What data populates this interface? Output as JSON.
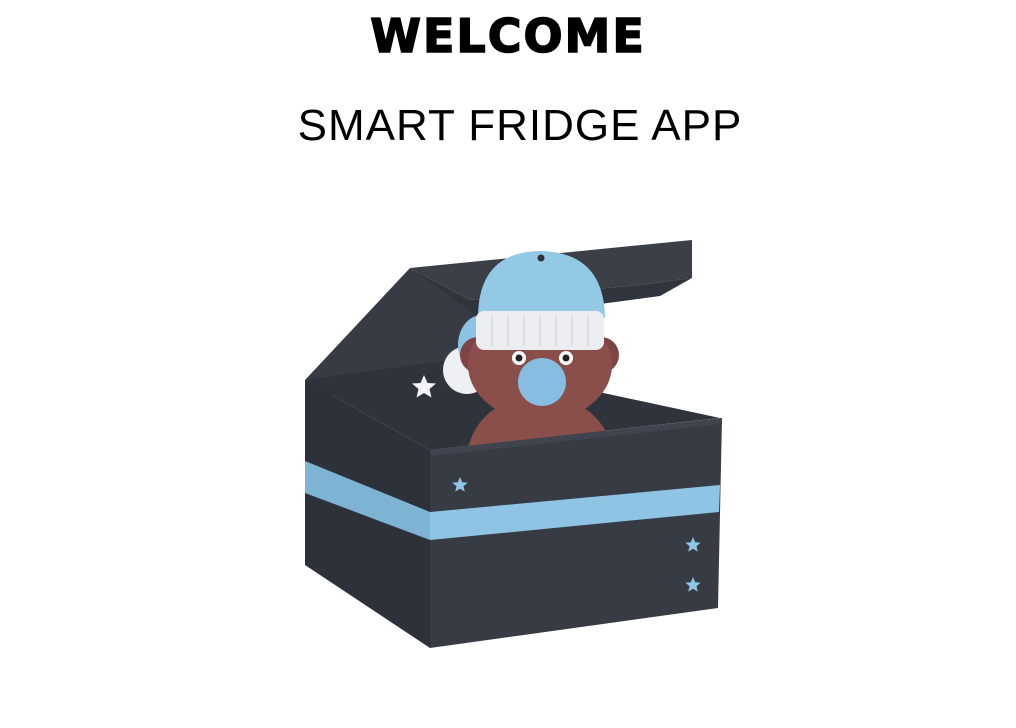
{
  "header": {
    "title": "WELCOME",
    "subtitle": "SMART FRIDGE APP"
  },
  "illustration": {
    "subject": "teddy bear in knit hat peeking out of an open gift box",
    "colors": {
      "box_dark": "#363b44",
      "box_darker": "#2d3139",
      "box_lid": "#3a3f48",
      "ribbon": "#8fc4e4",
      "hat": "#94c9e6",
      "hat_band": "#ecedf1",
      "bear": "#8a4f4b",
      "bear_dark": "#744140",
      "snout": "#86bde0",
      "star_white": "#f4f5f7",
      "star_blue": "#8fc4e4"
    }
  }
}
